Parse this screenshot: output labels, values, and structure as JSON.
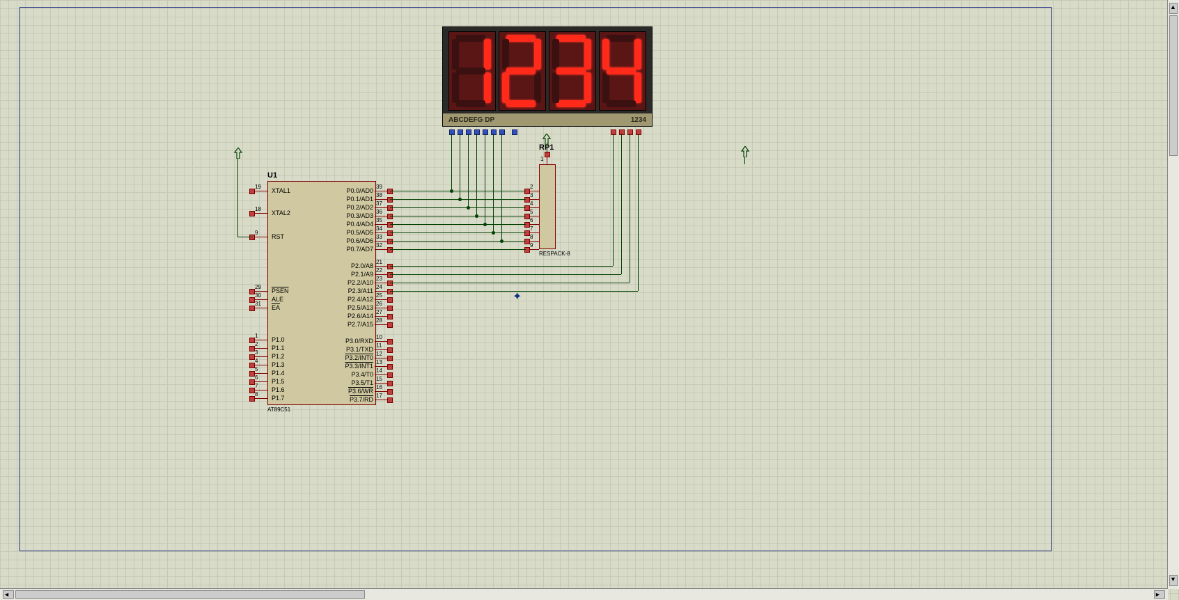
{
  "display": {
    "value": "1234",
    "segment_label": "ABCDEFG DP",
    "digit_label": "1234"
  },
  "mcu": {
    "designator": "U1",
    "part": "AT89C51",
    "left_pins": [
      {
        "num": "19",
        "name": "XTAL1"
      },
      {
        "num": "18",
        "name": "XTAL2"
      },
      {
        "num": "9",
        "name": "RST"
      },
      {
        "num": "29",
        "name": "PSEN",
        "over": true
      },
      {
        "num": "30",
        "name": "ALE"
      },
      {
        "num": "31",
        "name": "EA",
        "over": true
      },
      {
        "num": "1",
        "name": "P1.0"
      },
      {
        "num": "2",
        "name": "P1.1"
      },
      {
        "num": "3",
        "name": "P1.2"
      },
      {
        "num": "4",
        "name": "P1.3"
      },
      {
        "num": "5",
        "name": "P1.4"
      },
      {
        "num": "6",
        "name": "P1.5"
      },
      {
        "num": "7",
        "name": "P1.6"
      },
      {
        "num": "8",
        "name": "P1.7"
      }
    ],
    "right_pins": [
      {
        "num": "39",
        "name": "P0.0/AD0"
      },
      {
        "num": "38",
        "name": "P0.1/AD1"
      },
      {
        "num": "37",
        "name": "P0.2/AD2"
      },
      {
        "num": "36",
        "name": "P0.3/AD3"
      },
      {
        "num": "35",
        "name": "P0.4/AD4"
      },
      {
        "num": "34",
        "name": "P0.5/AD5"
      },
      {
        "num": "33",
        "name": "P0.6/AD6"
      },
      {
        "num": "32",
        "name": "P0.7/AD7"
      },
      {
        "num": "21",
        "name": "P2.0/A8"
      },
      {
        "num": "22",
        "name": "P2.1/A9"
      },
      {
        "num": "23",
        "name": "P2.2/A10"
      },
      {
        "num": "24",
        "name": "P2.3/A11"
      },
      {
        "num": "25",
        "name": "P2.4/A12"
      },
      {
        "num": "26",
        "name": "P2.5/A13"
      },
      {
        "num": "27",
        "name": "P2.6/A14"
      },
      {
        "num": "28",
        "name": "P2.7/A15"
      },
      {
        "num": "10",
        "name": "P3.0/RXD"
      },
      {
        "num": "11",
        "name": "P3.1/TXD"
      },
      {
        "num": "12",
        "name": "P3.2/INT0",
        "over": true
      },
      {
        "num": "13",
        "name": "P3.3/INT1",
        "over": true
      },
      {
        "num": "14",
        "name": "P3.4/T0"
      },
      {
        "num": "15",
        "name": "P3.5/T1"
      },
      {
        "num": "16",
        "name": "P3.6/WR",
        "over": true
      },
      {
        "num": "17",
        "name": "P3.7/RD",
        "over": true
      }
    ]
  },
  "respack": {
    "designator": "RP1",
    "part": "RESPACK-8",
    "top_pin": "1",
    "side_pins": [
      "2",
      "3",
      "4",
      "5",
      "6",
      "7",
      "8",
      "9"
    ]
  }
}
